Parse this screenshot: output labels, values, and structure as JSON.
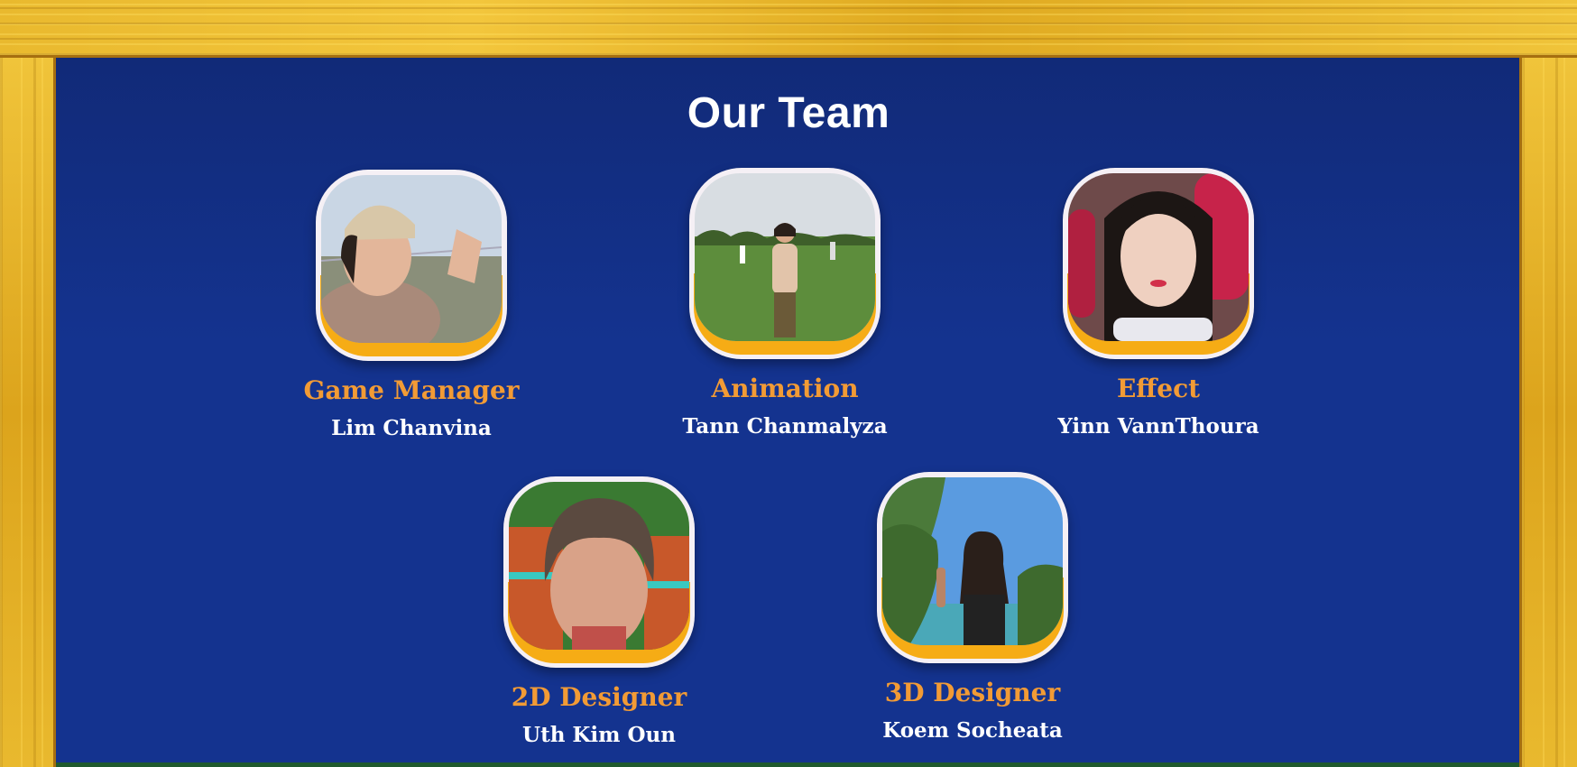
{
  "page": {
    "title": "Our Team"
  },
  "team": [
    {
      "role": "Game Manager",
      "name": "Lim Chanvina"
    },
    {
      "role": "Animation",
      "name": "Tann Chanmalyza"
    },
    {
      "role": "Effect",
      "name": "Yinn VannThoura"
    },
    {
      "role": "2D Designer",
      "name": "Uth Kim Oun"
    },
    {
      "role": "3D Designer",
      "name": "Koem Socheata"
    }
  ],
  "colors": {
    "board": "#14338f",
    "frame": "#e3b22a",
    "role_text": "#f29b35",
    "name_text": "#ffffff",
    "photo_accent": "#f6ac15"
  }
}
